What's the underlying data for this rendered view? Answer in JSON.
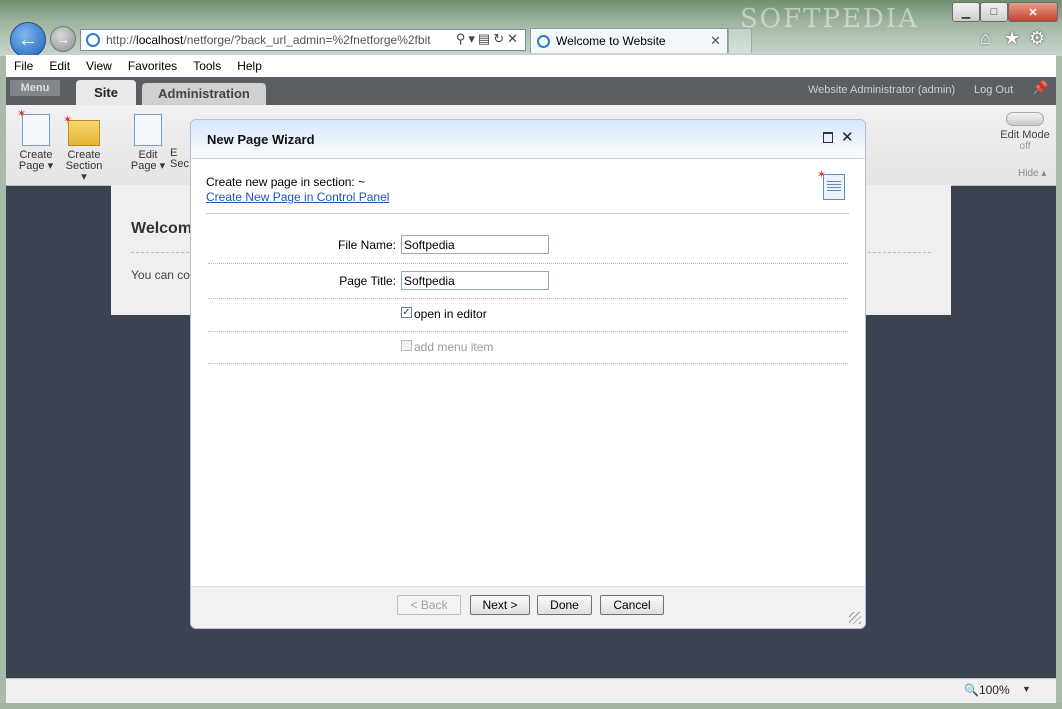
{
  "browser": {
    "title_watermark": "SOFTPEDIA",
    "address_host": "localhost",
    "address_prefix": "http://",
    "address_path": "/netforge/?back_url_admin=%2fnetforge%2fbit",
    "tab_title": "Welcome to Website",
    "zoom": "100%"
  },
  "menubar": [
    "File",
    "Edit",
    "View",
    "Favorites",
    "Tools",
    "Help"
  ],
  "cms": {
    "menu_label": "Menu",
    "tabs": [
      "Site",
      "Administration"
    ],
    "user_info": "Website Administrator (admin)",
    "logout_label": "Log Out",
    "ribbon": [
      {
        "line1": "Create",
        "line2": "Page ▾"
      },
      {
        "line1": "Create",
        "line2": "Section ▾"
      },
      {
        "line1": "Edit",
        "line2": "Page ▾"
      },
      {
        "line1": "E",
        "line2": "Sec"
      }
    ],
    "edit_mode_label": "Edit Mode",
    "edit_mode_state": "off",
    "hide_label": "Hide ▴"
  },
  "page": {
    "heading": "Welcom",
    "text": "You can co"
  },
  "dialog": {
    "title": "New Page Wizard",
    "section_text": "Create new page in section: ~",
    "control_panel_link": "Create New Page in Control Panel",
    "file_name_label": "File Name:",
    "file_name_value": "Softpedia",
    "page_title_label": "Page Title:",
    "page_title_value": "Softpedia",
    "open_in_editor_label": "open in editor",
    "open_in_editor_checked": true,
    "add_menu_item_label": "add menu item",
    "add_menu_item_checked": false,
    "buttons": {
      "back": "< Back",
      "next": "Next >",
      "done": "Done",
      "cancel": "Cancel"
    }
  },
  "colors": {
    "link": "#1c56b4",
    "page_background": "#3b4350",
    "dialog_header": "#d8e8f8"
  }
}
